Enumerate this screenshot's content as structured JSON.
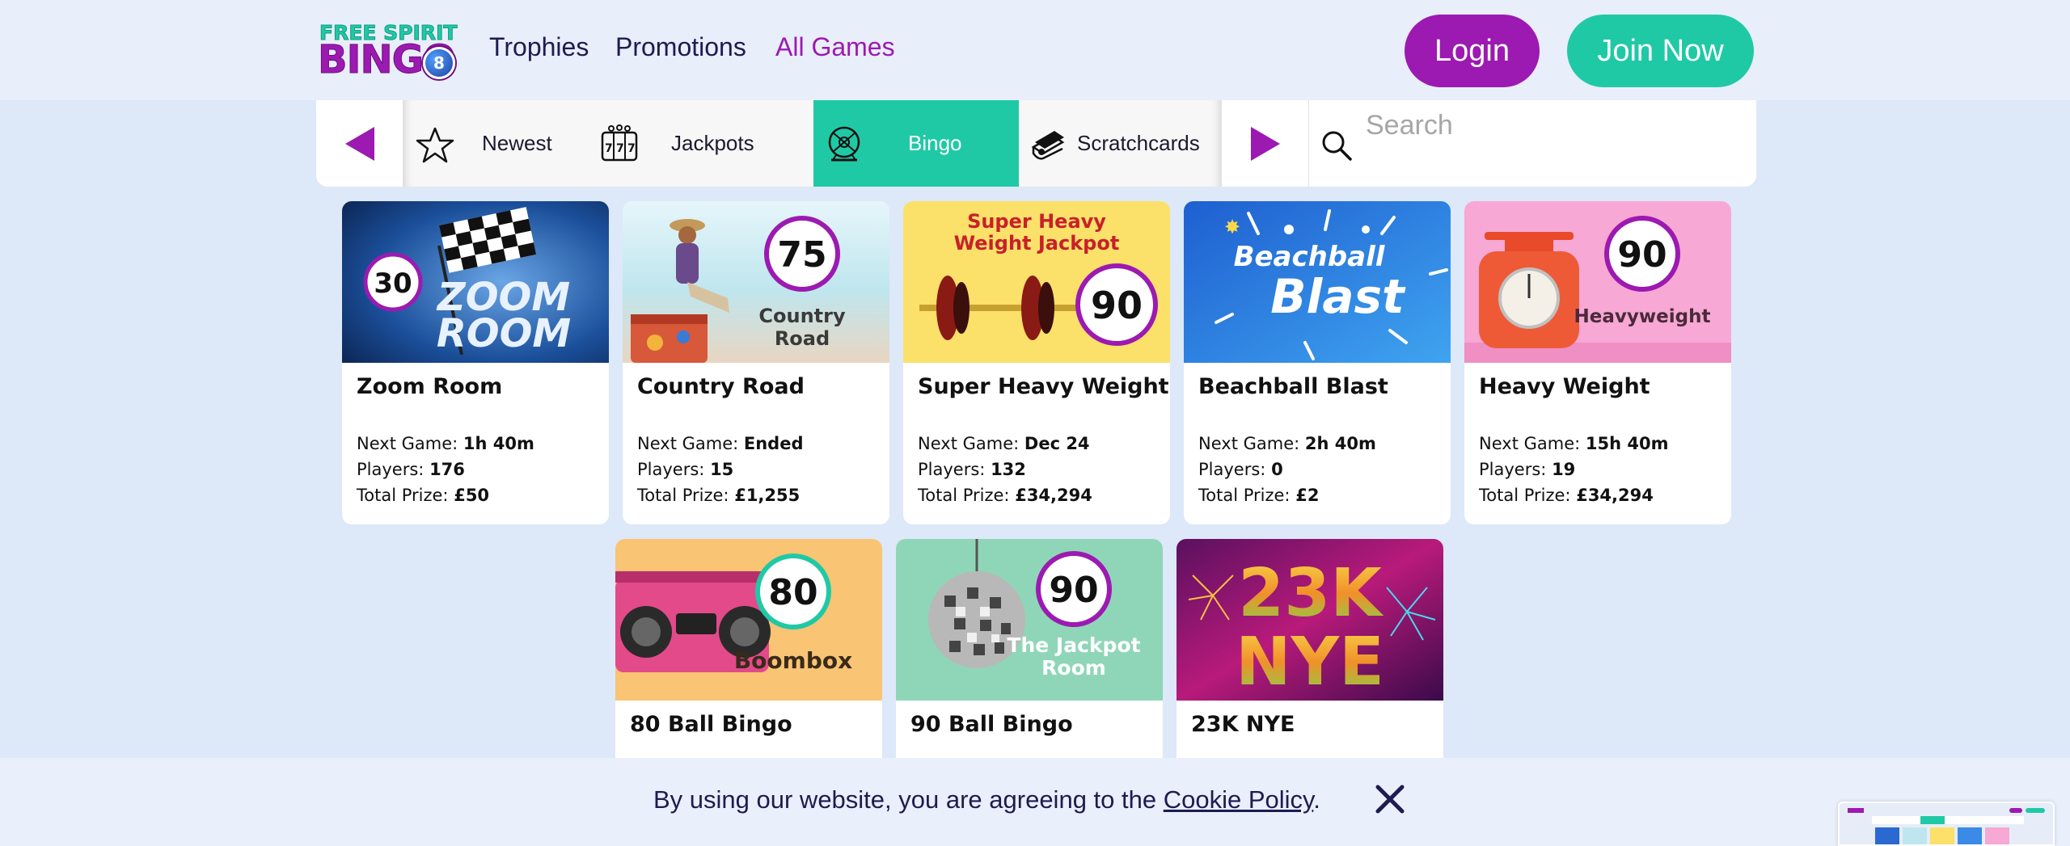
{
  "header": {
    "logo_line1": "FREE SPIRIT",
    "logo_line2": "BINGO",
    "logo_ball": "8",
    "nav": [
      {
        "label": "Trophies",
        "active": false
      },
      {
        "label": "Promotions",
        "active": false
      },
      {
        "label": "All Games",
        "active": true
      }
    ],
    "login_label": "Login",
    "join_label": "Join Now"
  },
  "categories": {
    "items": [
      {
        "label": "Newest",
        "icon": "star-icon"
      },
      {
        "label": "Jackpots",
        "icon": "slot-machine-icon"
      },
      {
        "label": "Bingo",
        "icon": "bingo-cage-icon",
        "active": true
      },
      {
        "label": "Scratchcards",
        "icon": "scratchcard-icon"
      }
    ],
    "search_placeholder": "Search"
  },
  "games": [
    {
      "title": "Zoom Room",
      "next_label": "Next Game:",
      "next": "1h 40m",
      "players_label": "Players:",
      "players": "176",
      "prize_label": "Total Prize:",
      "prize": "£50",
      "art": {
        "ball": "30",
        "text1": "ZOOM",
        "text2": "ROOM"
      }
    },
    {
      "title": "Country Road",
      "next_label": "Next Game:",
      "next": "Ended",
      "players_label": "Players:",
      "players": "15",
      "prize_label": "Total Prize:",
      "prize": "£1,255",
      "art": {
        "ball": "75",
        "text1": "Country",
        "text2": "Road"
      }
    },
    {
      "title": "Super Heavy Weight",
      "next_label": "Next Game:",
      "next": "Dec 24",
      "players_label": "Players:",
      "players": "132",
      "prize_label": "Total Prize:",
      "prize": "£34,294",
      "art": {
        "ball": "90",
        "text1": "Super Heavy",
        "text2": "Weight Jackpot"
      }
    },
    {
      "title": "Beachball Blast",
      "next_label": "Next Game:",
      "next": "2h 40m",
      "players_label": "Players:",
      "players": "0",
      "prize_label": "Total Prize:",
      "prize": "£2",
      "art": {
        "text1": "Beachball",
        "text2": "Blast"
      }
    },
    {
      "title": "Heavy Weight",
      "next_label": "Next Game:",
      "next": "15h 40m",
      "players_label": "Players:",
      "players": "19",
      "prize_label": "Total Prize:",
      "prize": "£34,294",
      "art": {
        "ball": "90",
        "text1": "Heavyweight"
      }
    },
    {
      "title": "80 Ball Bingo",
      "art": {
        "ball": "80",
        "text1": "Boombox"
      }
    },
    {
      "title": "90 Ball Bingo",
      "art": {
        "ball": "90",
        "text1": "The Jackpot",
        "text2": "Room"
      }
    },
    {
      "title": "23K NYE",
      "art": {
        "text1": "23K",
        "text2": "NYE"
      }
    }
  ],
  "cookie": {
    "text": "By using our website, you are agreeing to the",
    "link": "Cookie Policy",
    "after": "."
  },
  "colors": {
    "brand_purple": "#9c1ab1",
    "brand_teal": "#20c9a6",
    "nav_text": "#1c1c50",
    "page_bg": "#dde8f8"
  }
}
